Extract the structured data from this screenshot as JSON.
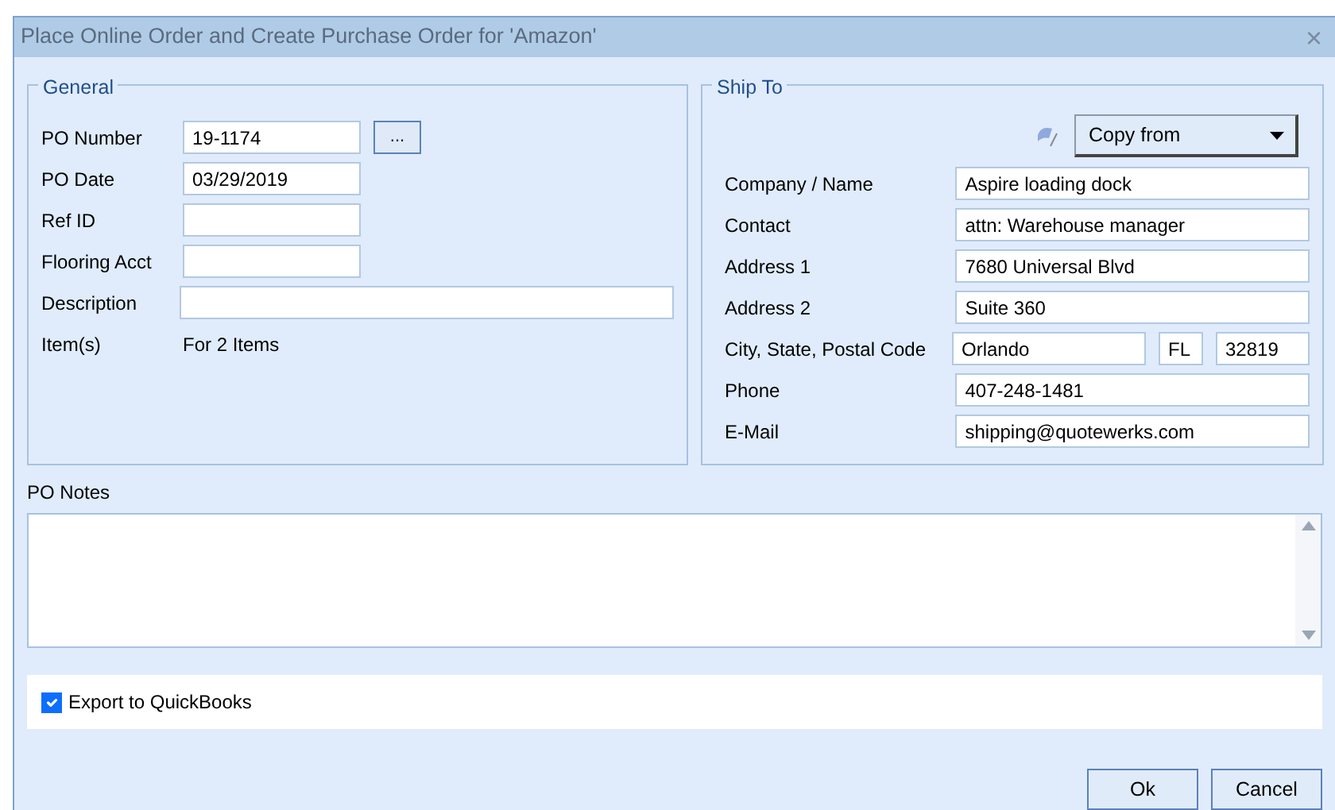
{
  "window": {
    "title": "Place Online Order and Create Purchase Order for 'Amazon'",
    "close": "×"
  },
  "general": {
    "title": "General",
    "fields": [
      {
        "kind": "input",
        "label": "PO Number",
        "value": "19-1174",
        "browse": "..."
      },
      {
        "kind": "input",
        "label": "PO Date",
        "value": "03/29/2019"
      },
      {
        "kind": "input",
        "label": "Ref ID"
      },
      {
        "kind": "input",
        "label": "Flooring Acct"
      },
      {
        "kind": "wide",
        "label": "Description"
      },
      {
        "kind": "text",
        "label": "Item(s)",
        "value": "For 2 Items"
      }
    ]
  },
  "ship_to": {
    "title": "Ship To",
    "copy_from": "Copy from",
    "fields": [
      {
        "label": "Company / Name",
        "values": [
          "Aspire loading dock"
        ]
      },
      {
        "label": "Contact",
        "values": [
          "attn: Warehouse manager"
        ]
      },
      {
        "label": "Address 1",
        "values": [
          "7680 Universal Blvd"
        ]
      },
      {
        "label": "Address 2",
        "values": [
          "Suite 360"
        ]
      },
      {
        "label": "City, State, Postal Code",
        "values": [
          "Orlando",
          "FL",
          "32819"
        ]
      },
      {
        "label": "Phone",
        "values": [
          "407-248-1481"
        ]
      },
      {
        "label": "E-Mail",
        "values": [
          "shipping@quotewerks.com"
        ]
      }
    ]
  },
  "po_notes": {
    "label": "PO Notes"
  },
  "export": {
    "label": "Export to QuickBooks",
    "checked": true
  },
  "buttons": [
    "Ok",
    "Cancel"
  ]
}
